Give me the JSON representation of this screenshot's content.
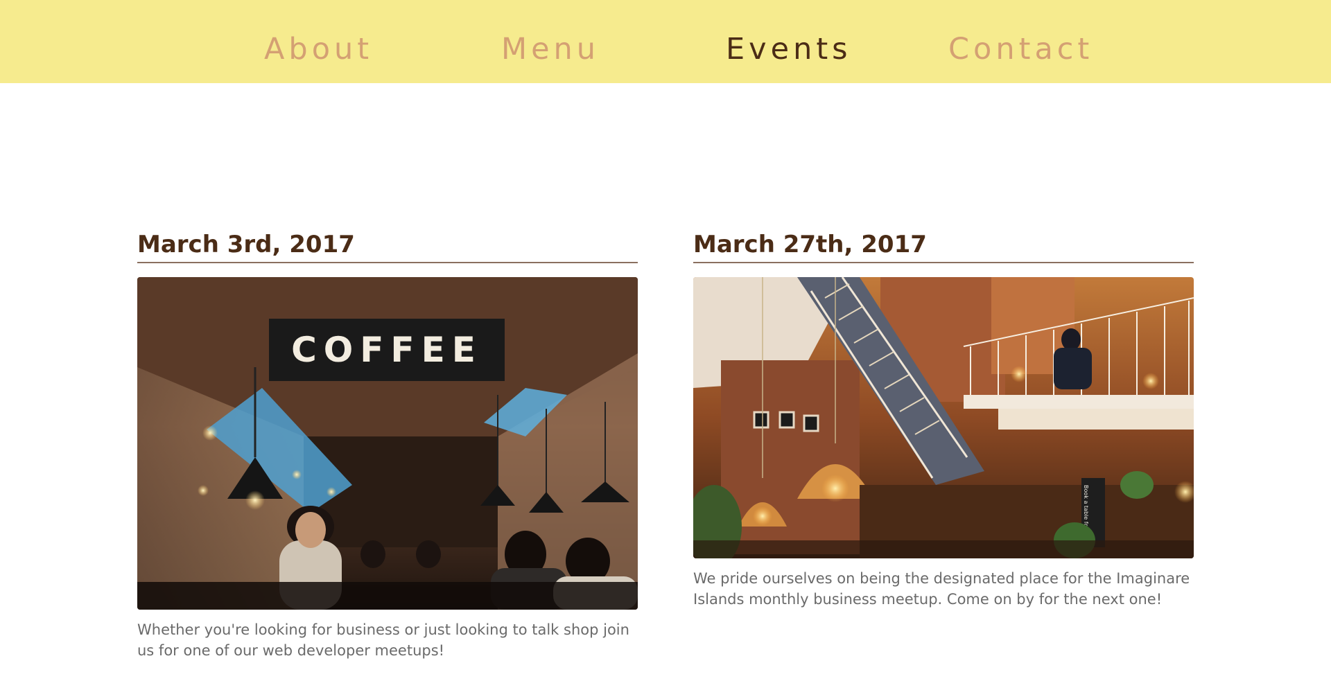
{
  "nav": {
    "items": [
      {
        "label": "About",
        "active": false
      },
      {
        "label": "Menu",
        "active": false
      },
      {
        "label": "Events",
        "active": true
      },
      {
        "label": "Contact",
        "active": false
      }
    ]
  },
  "events": [
    {
      "date": "March 3rd, 2017",
      "photo_sign": "COFFEE",
      "description": "Whether you're looking for business or just looking to talk shop join us for one of our web developer meetups!"
    },
    {
      "date": "March 27th, 2017",
      "photo_chalkboard": "Book a table for Dinner",
      "description": "We pride ourselves on being the designated place for the Imaginare Islands monthly business meetup. Come on by for the next one!"
    }
  ],
  "colors": {
    "nav_background": "#f6eb8e",
    "nav_link": "#d4a073",
    "nav_link_active": "#4b2c16",
    "heading": "#4b2c16",
    "body_text": "#6a6a6a"
  }
}
